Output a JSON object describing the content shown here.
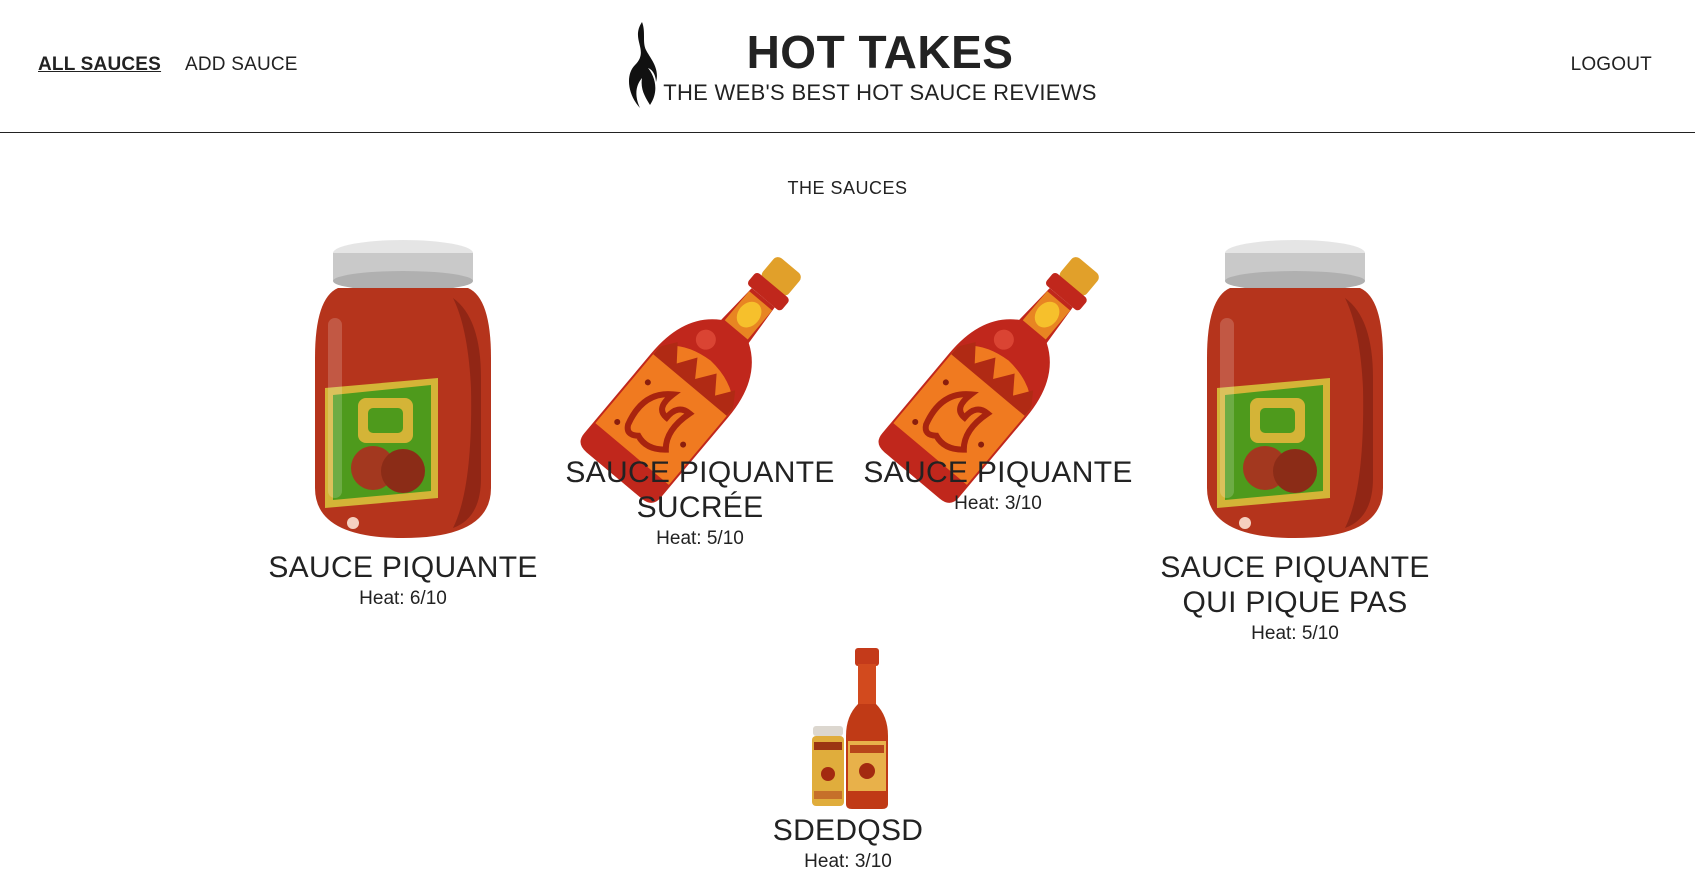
{
  "nav": {
    "all_sauces": "ALL SAUCES",
    "add_sauce": "ADD SAUCE",
    "logout": "LOGOUT"
  },
  "brand": {
    "title": "HOT TAKES",
    "subtitle": "THE WEB'S BEST HOT SAUCE REVIEWS"
  },
  "section_title": "THE SAUCES",
  "sauces": [
    {
      "name": "SAUCE PIQUANTE",
      "heat": "Heat: 6/10",
      "image": "jar"
    },
    {
      "name": "SAUCE PIQUANTE SUCRÉE",
      "heat": "Heat: 5/10",
      "image": "bottle"
    },
    {
      "name": "SAUCE PIQUANTE",
      "heat": "Heat: 3/10",
      "image": "bottle"
    },
    {
      "name": "SAUCE PIQUANTE QUI PIQUE PAS",
      "heat": "Heat: 5/10",
      "image": "jar"
    },
    {
      "name": "SDEDQSD",
      "heat": "Heat: 3/10",
      "image": "louisiana-bottles"
    }
  ],
  "colors": {
    "text": "#222222",
    "sauce_red": "#b5341c",
    "label_green": "#4e9a1c",
    "cap_grey": "#c8c8c8",
    "bottle_orange": "#f07a20"
  }
}
